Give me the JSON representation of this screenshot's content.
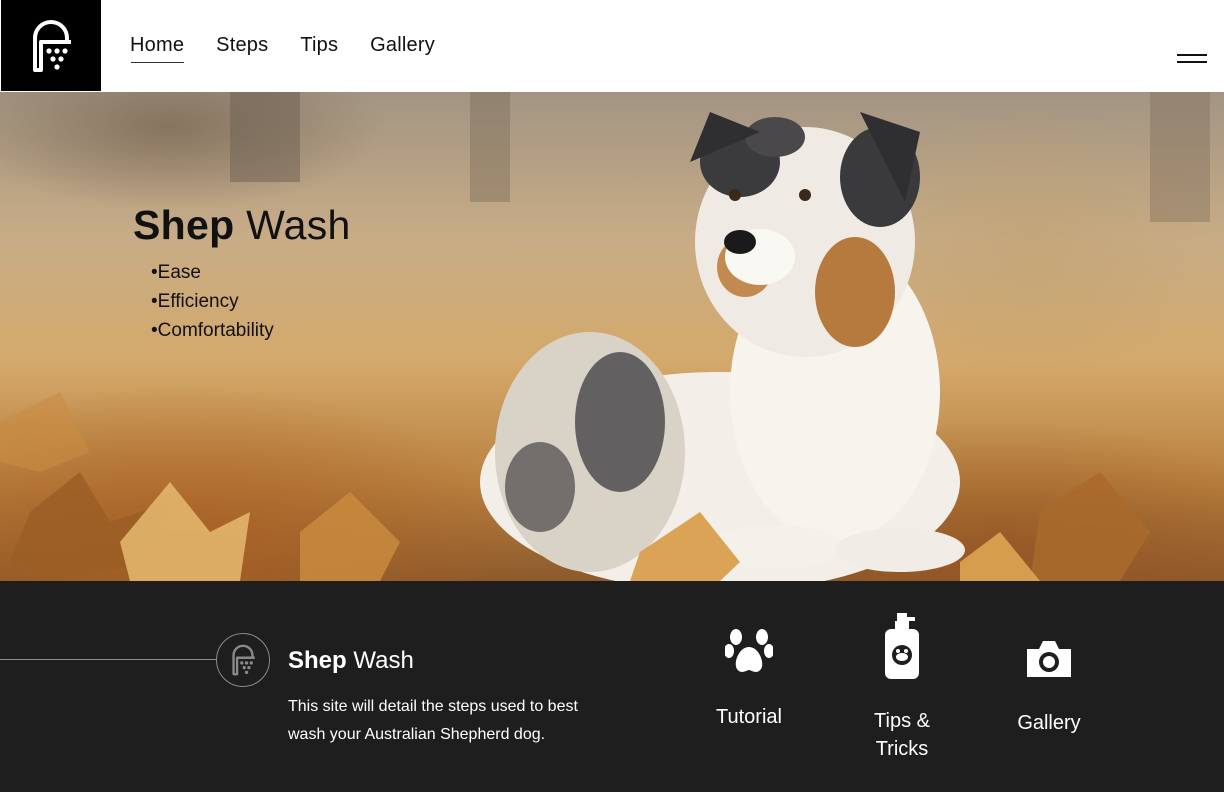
{
  "header": {
    "logo_icon": "shower-icon",
    "nav": [
      {
        "label": "Home",
        "active": true
      },
      {
        "label": "Steps",
        "active": false
      },
      {
        "label": "Tips",
        "active": false
      },
      {
        "label": "Gallery",
        "active": false
      }
    ],
    "menu_icon": "hamburger-menu-icon"
  },
  "hero": {
    "title_bold": "Shep",
    "title_light": "Wash",
    "bullets": [
      "•Ease",
      "•Efficiency",
      "•Comfortability"
    ],
    "image": "australian-shepherd-in-autumn-leaves"
  },
  "footer": {
    "logo_icon": "shower-icon",
    "title_bold": "Shep",
    "title_light": "Wash",
    "description": "This site will detail the steps used to best wash your Australian Shepherd dog.",
    "links": [
      {
        "label": "Tutorial",
        "icon": "paw-icon"
      },
      {
        "label": "Tips & Tricks",
        "icon": "shampoo-bottle-icon"
      },
      {
        "label": "Gallery",
        "icon": "camera-icon"
      }
    ]
  },
  "colors": {
    "logo_bg": "#000000",
    "footer_bg": "#1e1e1e",
    "text_dark": "#111111",
    "text_light": "#ffffff"
  }
}
